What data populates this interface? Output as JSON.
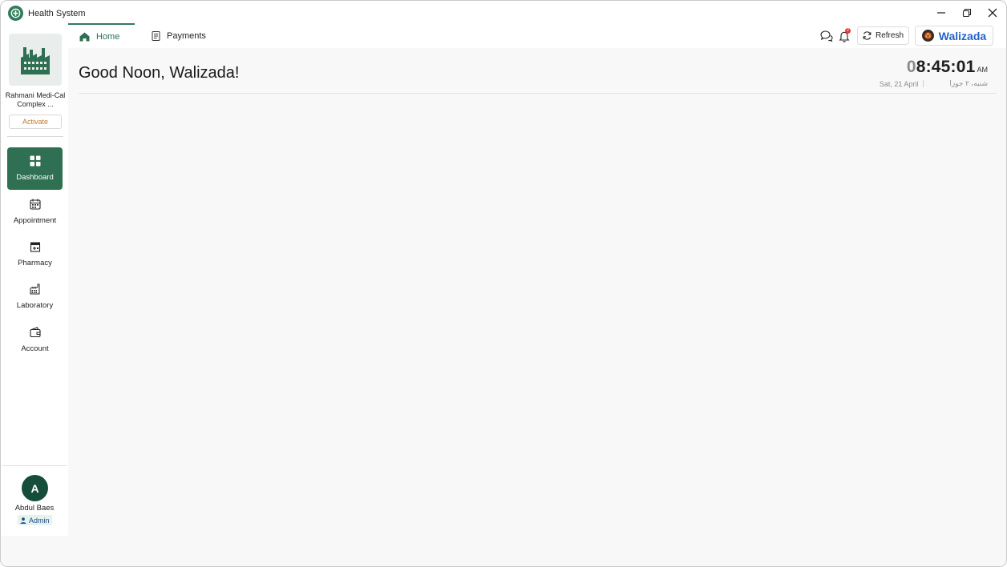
{
  "window": {
    "title": "Health System",
    "controls": [
      "minimize-icon",
      "restore-icon",
      "close-icon"
    ]
  },
  "sidebar": {
    "org_name": "Rahmani Medi-Cal Complex ...",
    "activate_label": "Activate",
    "items": [
      {
        "label": "Dashboard",
        "icon": "dashboard-icon",
        "active": true
      },
      {
        "label": "Appointment",
        "icon": "appointment-icon",
        "active": false
      },
      {
        "label": "Pharmacy",
        "icon": "pharmacy-icon",
        "active": false
      },
      {
        "label": "Laboratory",
        "icon": "laboratory-icon",
        "active": false
      },
      {
        "label": "Account",
        "icon": "wallet-icon",
        "active": false
      }
    ],
    "user": {
      "initial": "A",
      "name": "Abdul Baes",
      "role": "Admin"
    }
  },
  "tabs": [
    {
      "label": "Home",
      "icon": "home-icon",
      "active": true
    },
    {
      "label": "Payments",
      "icon": "receipt-icon",
      "active": false
    }
  ],
  "header": {
    "refresh_label": "Refresh",
    "notification_badge": "2",
    "profile_name": "Walizada"
  },
  "main": {
    "greeting": "Good Noon, Walizada!",
    "clock": {
      "time_lead": "0",
      "time_rest": "8:45:01",
      "ampm": "AM",
      "date_gregorian": "Sat, 21 April",
      "date_solar": "شنبه، ۲ جوزا"
    }
  },
  "colors": {
    "accent": "#2f6f52",
    "brand_text": "#2563c9",
    "activate_text": "#c07a2b",
    "badge_red": "#e53935"
  }
}
